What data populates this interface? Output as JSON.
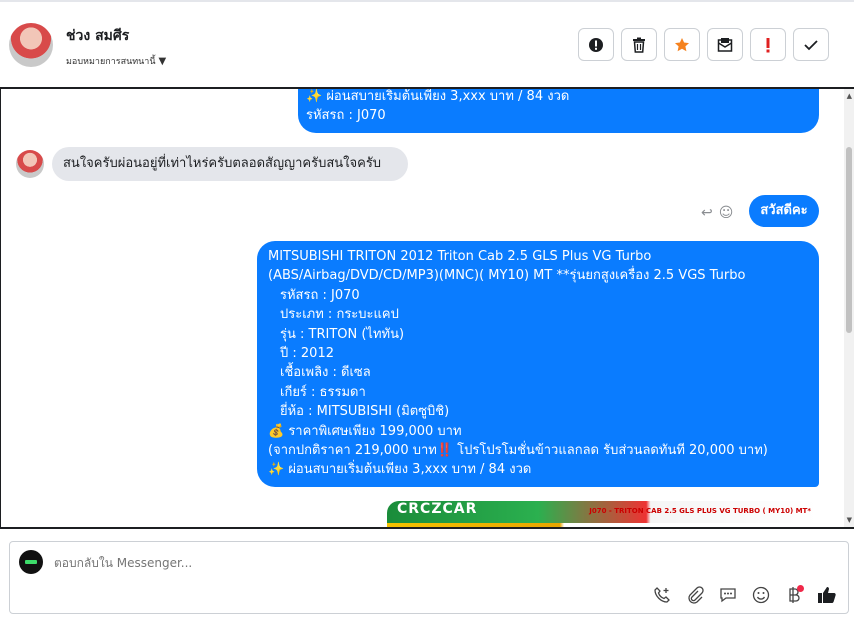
{
  "header": {
    "contact_name": "ช่วง สมศีร",
    "assign_label": "มอบหมายการสนทนานี้",
    "actions": [
      "spam",
      "delete",
      "star",
      "mark-unread",
      "follow-up",
      "done"
    ]
  },
  "messages": {
    "partial_top": {
      "line1": "✨ ผ่อนสบายเริ่มต้นเพียง 3,xxx บาท / 84 งวด",
      "line2": "รหัสรถ : J070"
    },
    "incoming": "สนใจครับผ่อนอยู่ที่เท่าไหร่ครับตลอดสัญญาครับสนใจครับ",
    "greeting": "สวัสดีคะ",
    "detail": {
      "l1": "MITSUBISHI TRITON 2012 Triton Cab 2.5 GLS Plus VG Turbo",
      "l2": "(ABS/Airbag/DVD/CD/MP3)(MNC)( MY10) MT **รุ่นยกสูงเครื่อง 2.5 VGS Turbo",
      "l3": "รหัสรถ : J070",
      "l4": "ประเภท : กระบะแคป",
      "l5": "รุ่น : TRITON (ไททัน)",
      "l6": "ปี : 2012",
      "l7": "เชื้อเพลิง : ดีเซล",
      "l8": "เกียร์ : ธรรมดา",
      "l9": "ยี่ห้อ : MITSUBISHI (มิตซูบิชิ)",
      "l10": "💰 ราคาพิเศษเพียง 199,000 บาท",
      "l11": "(จากปกติราคา 219,000 บาท‼️ โปรโปรโมชั่นข้าวแลกลด รับส่วนลดทันที 20,000 บาท)",
      "l12": "✨ ผ่อนสบายเริ่มต้นเพียง 3,xxx บาท / 84 งวด"
    },
    "image_caption": "J070 - TRITON CAB 2.5 GLS PLUS VG TURBO ( MY10) MT*"
  },
  "composer": {
    "placeholder": "ตอบกลับใน Messenger..."
  },
  "colors": {
    "outgoing_bubble": "#0a7cff",
    "incoming_bubble": "#e4e6eb",
    "star": "#f5821f",
    "follow_up": "#e02020"
  }
}
